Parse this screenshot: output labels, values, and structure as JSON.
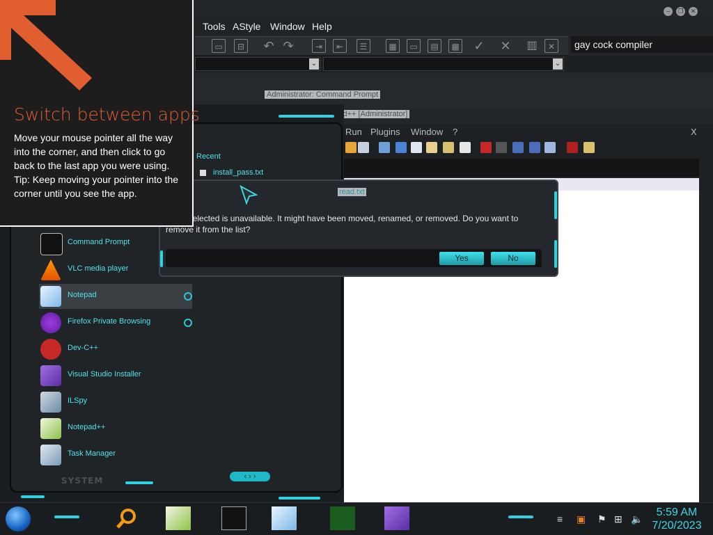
{
  "ide": {
    "menu": [
      "Tools",
      "AStyle",
      "Window",
      "Help"
    ],
    "search_value": "gay cock compiler"
  },
  "background_tabs": {
    "cmd_title": "Administrator: Command Prompt",
    "npp_title": "Notepad++ [Administrator]"
  },
  "npp": {
    "menu": [
      "Run",
      "Plugins",
      "Window",
      "?"
    ],
    "close_glyph": "X"
  },
  "start_menu": {
    "recent_label": "Recent",
    "recent_item": "install_pass.txt",
    "items": [
      {
        "label": "Command Prompt",
        "icon": "command-prompt-icon"
      },
      {
        "label": "VLC media player",
        "icon": "vlc-icon"
      },
      {
        "label": "Notepad",
        "icon": "notepad-icon"
      },
      {
        "label": "Firefox Private Browsing",
        "icon": "firefox-private-icon"
      },
      {
        "label": "Dev-C++",
        "icon": "devcpp-icon"
      },
      {
        "label": "Visual Studio Installer",
        "icon": "visual-studio-installer-icon"
      },
      {
        "label": "ILSpy",
        "icon": "ilspy-icon"
      },
      {
        "label": "Notepad++",
        "icon": "notepadpp-icon"
      },
      {
        "label": "Task Manager",
        "icon": "task-manager-icon"
      }
    ],
    "system_label": "SYSTEM"
  },
  "dialog": {
    "title": "read.txt",
    "message": "n you selected is unavailable.  It might have been moved, renamed, or removed.  Do you want to remove it from the list?",
    "yes_label": "Yes",
    "no_label": "No"
  },
  "tip": {
    "title": "Switch between apps",
    "body_1": "Move your mouse pointer all the way into the corner, and then click to go back to the last app you were using.",
    "body_2": "Tip: Keep moving your pointer into the corner until you see the app."
  },
  "taskbar": {
    "time": "5:59 AM",
    "date": "7/20/2023"
  },
  "colors": {
    "accent": "#2ed2e0",
    "tip_title": "#e05e30"
  }
}
